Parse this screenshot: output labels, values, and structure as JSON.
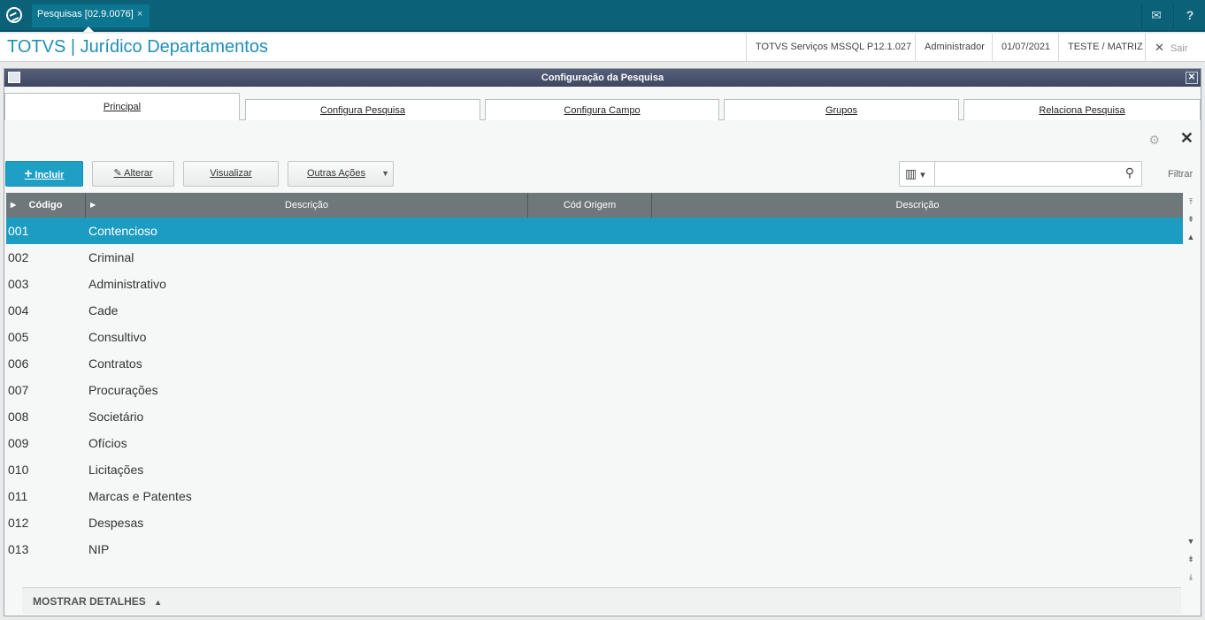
{
  "topbar": {
    "tab_label": "Pesquisas [02.9.0076]",
    "tab_close": "×",
    "mail_icon": "✉",
    "help_icon": "?"
  },
  "header": {
    "brand": "TOTVS | Jurídico Departamentos",
    "environment": "TOTVS Serviços MSSQL P12.1.027",
    "user": "Administrador",
    "date": "01/07/2021",
    "company": "TESTE / MATRIZ",
    "exit_icon": "✕",
    "exit_label": "Sair"
  },
  "dialog": {
    "title": "Configuração da Pesquisa",
    "close": "✕",
    "tabs": [
      "Principal",
      "Configura Pesquisa",
      "Configura Campo",
      "Grupos",
      "Relaciona Pesquisa"
    ],
    "gear_icon": "⚙",
    "close_panel": "✕"
  },
  "toolbar": {
    "include": "Incluir",
    "include_icon": "+",
    "edit": "Alterar",
    "edit_icon": "✎",
    "view": "Visualizar",
    "other": "Outras Ações",
    "other_arrow": "▼",
    "columns_icon": "▥",
    "columns_arrow": "▾",
    "search_icon": "⚲",
    "search_placeholder": "",
    "filter": "Filtrar"
  },
  "grid": {
    "columns": [
      "Código",
      "Descrição",
      "Cód Origem",
      "Descrição"
    ],
    "rows": [
      {
        "code": "001",
        "desc": "Contencioso"
      },
      {
        "code": "002",
        "desc": "Criminal"
      },
      {
        "code": "003",
        "desc": "Administrativo"
      },
      {
        "code": "004",
        "desc": "Cade"
      },
      {
        "code": "005",
        "desc": "Consultivo"
      },
      {
        "code": "006",
        "desc": "Contratos"
      },
      {
        "code": "007",
        "desc": "Procurações"
      },
      {
        "code": "008",
        "desc": "Societário"
      },
      {
        "code": "009",
        "desc": "Ofícios"
      },
      {
        "code": "010",
        "desc": "Licitações"
      },
      {
        "code": "011",
        "desc": "Marcas e Patentes"
      },
      {
        "code": "012",
        "desc": "Despesas"
      },
      {
        "code": "013",
        "desc": "NIP"
      }
    ],
    "selected_index": 0
  },
  "details": {
    "label": "MOSTRAR DETALHES",
    "arrow": "▲"
  },
  "colors": {
    "topbar": "#0a6178",
    "brand": "#1f8fb7",
    "selection": "#1c9cc1",
    "grid_header": "#6e7779"
  }
}
